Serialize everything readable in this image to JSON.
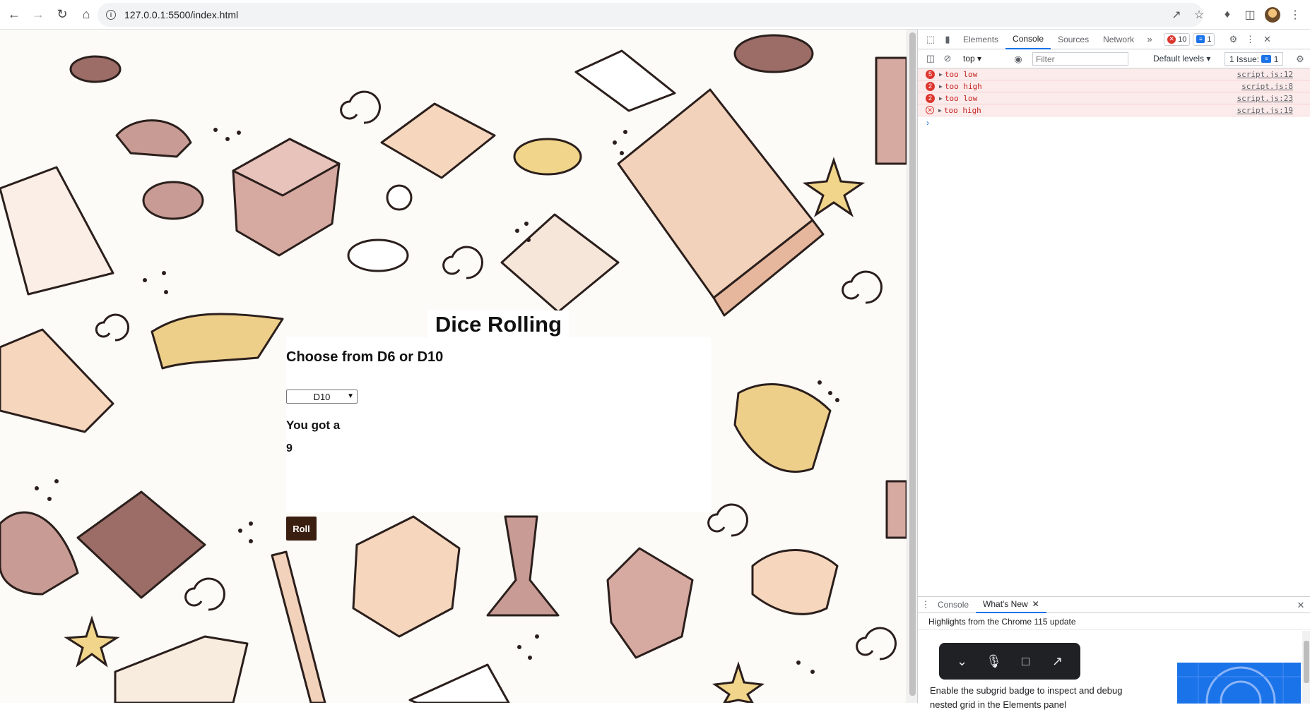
{
  "browser": {
    "url": "127.0.0.1:5500/index.html"
  },
  "app": {
    "title": "Dice Rolling",
    "subtitle": "Choose from D6 or D10",
    "select_value": "D10",
    "result_label": "You got a",
    "result_value": "9",
    "roll_label": "Roll"
  },
  "devtools": {
    "tabs": [
      "Elements",
      "Console",
      "Sources",
      "Network"
    ],
    "active_tab": "Console",
    "error_count": "10",
    "message_count": "1",
    "context": "top",
    "filter_placeholder": "Filter",
    "levels": "Default levels",
    "issues": "1 Issue:",
    "issues_count": "1",
    "logs": [
      {
        "count": "5",
        "text": "too low",
        "source": "script.js:12"
      },
      {
        "count": "2",
        "text": "too high",
        "source": "script.js:8"
      },
      {
        "count": "2",
        "text": "too low",
        "source": "script.js:23"
      },
      {
        "count": "",
        "text": "too high",
        "source": "script.js:19"
      }
    ],
    "drawer": {
      "tabs": [
        "Console",
        "What's New"
      ],
      "active": "What's New",
      "highlights": "Highlights from the Chrome 115 update",
      "promo_text": "Enable the subgrid badge to inspect and debug nested grid in the Elements panel"
    }
  },
  "colors": {
    "roll_button": "#3a1f10",
    "error_red": "#dc362e",
    "accent_blue": "#1a73e8"
  }
}
